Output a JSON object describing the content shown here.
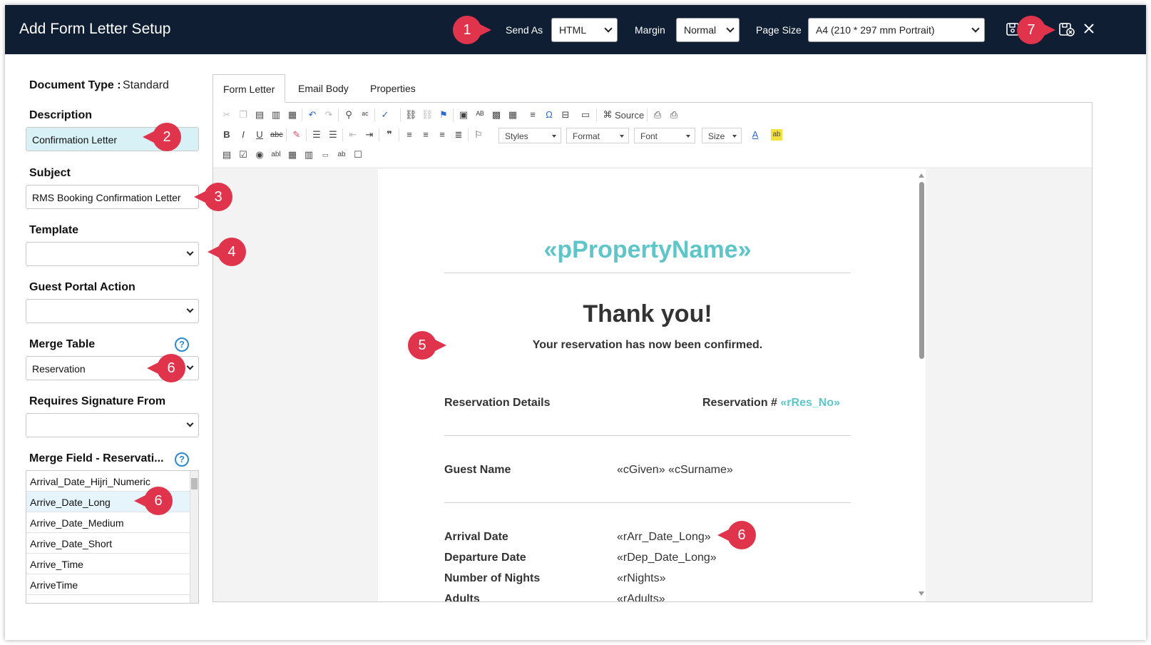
{
  "header": {
    "title": "Add Form Letter Setup",
    "send_as_label": "Send As",
    "send_as_value": "HTML",
    "margin_label": "Margin",
    "margin_value": "Normal",
    "page_size_label": "Page Size",
    "page_size_value": "A4 (210 * 297 mm Portrait)",
    "icons": [
      "save-icon",
      "save-and-close-icon",
      "close-icon"
    ]
  },
  "callouts": [
    "1",
    "2",
    "3",
    "4",
    "5",
    "6",
    "6",
    "6",
    "7"
  ],
  "left_panel": {
    "document_type_label": "Document Type :",
    "document_type_value": "Standard",
    "description_label": "Description",
    "description_value": "Confirmation Letter",
    "subject_label": "Subject",
    "subject_value": "RMS Booking Confirmation Letter",
    "template_label": "Template",
    "template_value": "",
    "guest_portal_action_label": "Guest Portal Action",
    "guest_portal_action_value": "",
    "merge_table_label": "Merge Table",
    "merge_table_value": "Reservation",
    "requires_signature_label": "Requires Signature From",
    "requires_signature_value": "",
    "merge_field_label": "Merge Field - Reservati...",
    "merge_fields": [
      "Arrival_Date_Hijri_Numeric",
      "Arrive_Date_Long",
      "Arrive_Date_Medium",
      "Arrive_Date_Short",
      "Arrive_Time",
      "ArriveTime"
    ]
  },
  "tabs": [
    "Form Letter",
    "Email Body",
    "Properties"
  ],
  "toolbar": {
    "source_label": "Source",
    "styles_label": "Styles",
    "format_label": "Format",
    "font_label": "Font",
    "size_label": "Size"
  },
  "letter": {
    "property_name": "«pPropertyName»",
    "thanks": "Thank you!",
    "confirmed": "Your reservation has now been confirmed.",
    "reservation_details": "Reservation Details",
    "reservation_no_label": "Reservation # ",
    "reservation_no_code": "«rRes_No»",
    "guest_name_label": "Guest Name",
    "guest_name_value": "«cGiven» «cSurname»",
    "arrival_label": "Arrival Date",
    "arrival_value": "«rArr_Date_Long»",
    "departure_label": "Departure Date",
    "departure_value": "«rDep_Date_Long»",
    "nights_label": "Number of Nights",
    "nights_value": "«rNights»",
    "adults_label": "Adults",
    "adults_value": "«rAdults»"
  },
  "colors": {
    "header_bg": "#0f1e33",
    "callout": "#e0344c",
    "merge_code": "#5ec6c9",
    "description_bg": "#d8f1f7"
  }
}
